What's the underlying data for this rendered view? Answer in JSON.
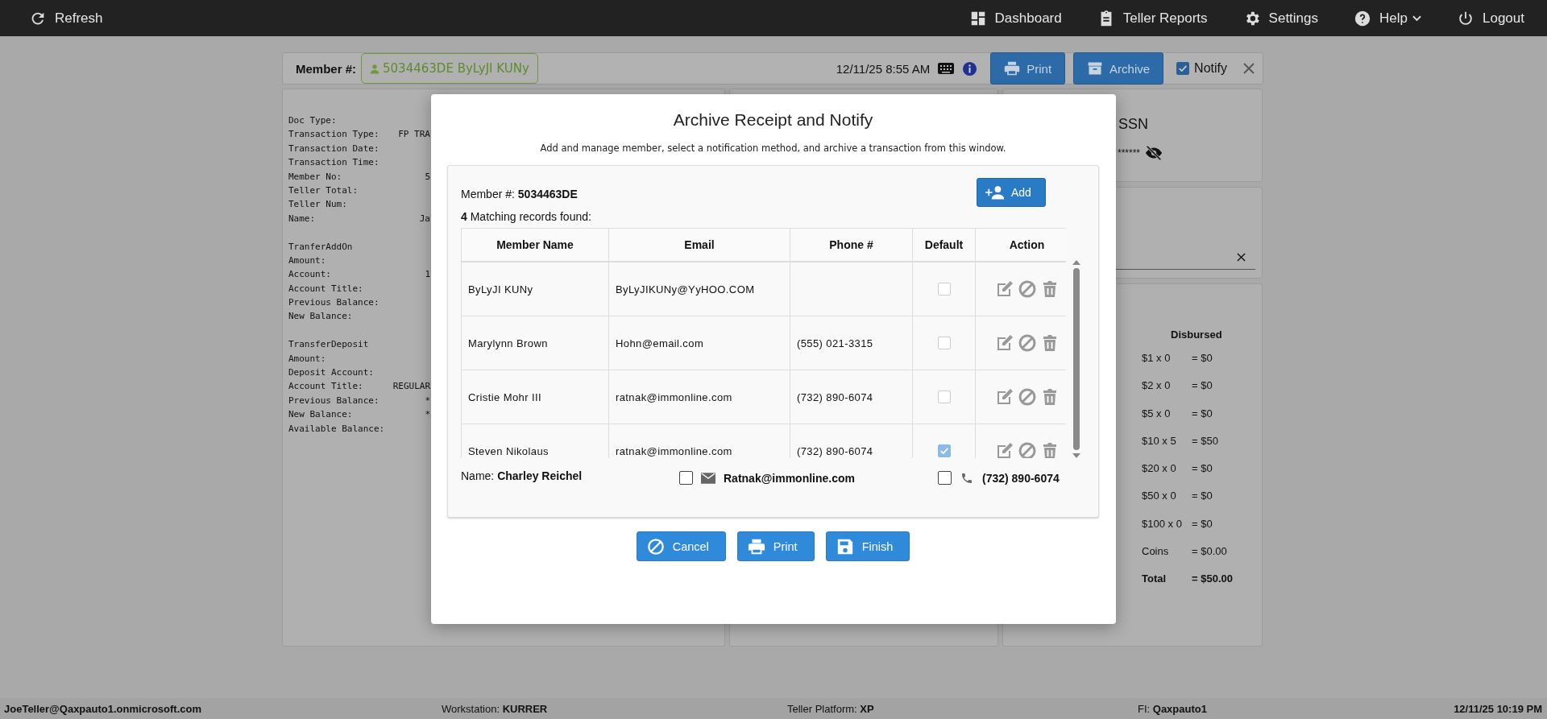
{
  "top_bar": {
    "items": [
      {
        "label": "Refresh",
        "kind": "refresh"
      },
      {
        "label": "Dashboard",
        "kind": "dashboard"
      },
      {
        "label": "Teller Reports",
        "kind": "reports"
      },
      {
        "label": "Settings",
        "kind": "settings"
      },
      {
        "label": "Help",
        "kind": "help"
      },
      {
        "label": "Logout",
        "kind": "logout"
      }
    ]
  },
  "member_bar": {
    "label": "Member #:",
    "member": "5034463DE ByLyJI KUNy",
    "datetime": "12/11/25 8:55 AM",
    "buttons": [
      {
        "label": "Print",
        "kind": "print"
      },
      {
        "label": "Archive",
        "kind": "archive"
      }
    ],
    "notify": {
      "label": "Notify",
      "checked": true
    }
  },
  "receipt": {
    "sections": [
      {
        "lines": [
          {
            "label": "Doc Type:"
          },
          {
            "label": "Transaction Type:",
            "value": "FP TRA"
          },
          {
            "label": "Transaction Date:"
          },
          {
            "label": "Transaction Time:"
          },
          {
            "label": "Member No:",
            "value": "5"
          },
          {
            "label": "Teller Total:"
          },
          {
            "label": "Teller Num:"
          },
          {
            "label": "Name:",
            "value": "Ja"
          }
        ]
      },
      {
        "title": "TranferAddOn",
        "lines": [
          {
            "label": "Amount:"
          },
          {
            "label": "Account:",
            "value": "1"
          },
          {
            "label": "Account Title:"
          },
          {
            "label": "Previous Balance:"
          },
          {
            "label": "New Balance:"
          }
        ]
      },
      {
        "title": "TransferDeposit",
        "lines": [
          {
            "label": "Amount:"
          },
          {
            "label": "Deposit Account:"
          },
          {
            "label": "Account Title:",
            "value": "REGULAR"
          },
          {
            "label": "Previous Balance:",
            "value": "*"
          },
          {
            "label": "New Balance:",
            "value": "*"
          },
          {
            "label": "Available Balance:"
          }
        ]
      }
    ]
  },
  "ssn": {
    "label": "SSN",
    "value": "******"
  },
  "disbursed": {
    "title": "Disbursed",
    "rows": [
      {
        "denomination": "$1 x 0",
        "amount": "= $0",
        "kind": "row"
      },
      {
        "denomination": "$2 x 0",
        "amount": "= $0",
        "kind": "row"
      },
      {
        "denomination": "$5 x 0",
        "amount": "= $0",
        "kind": "row"
      },
      {
        "denomination": "$10 x 5",
        "amount": "= $50",
        "kind": "row"
      },
      {
        "denomination": "$20 x 0",
        "amount": "= $0",
        "kind": "row"
      },
      {
        "denomination": "$50 x 0",
        "amount": "= $0",
        "kind": "row"
      },
      {
        "denomination": "$100 x 0",
        "amount": "= $0",
        "kind": "row"
      },
      {
        "denomination": "Coins",
        "amount": "= $0.00",
        "kind": "row"
      },
      {
        "denomination": "Total",
        "amount": "= $50.00",
        "kind": "total"
      }
    ]
  },
  "modal": {
    "title": "Archive Receipt and Notify",
    "subtitle": "Add and manage member, select a notification method, and archive a transaction from this window.",
    "member_label": "Member #:",
    "member_number": "5034463DE",
    "add_button": "Add",
    "matching": "**4** Matching records found:",
    "table": {
      "columns": [
        "Member Name",
        "Email",
        "Phone #",
        "Default",
        "Action"
      ],
      "rows": [
        {
          "name": "ByLyJI KUNy",
          "email": "ByLyJIKUNy@YyHOO.COM",
          "default": false
        },
        {
          "name": "Marylynn Brown",
          "email": "Hohn@email.com",
          "phone": "(555) 021-3315",
          "default": false
        },
        {
          "name": "Cristie Mohr III",
          "email": "ratnak@immonline.com",
          "phone": "(732) 890-6074",
          "default": false
        },
        {
          "name": "Steven Nikolaus",
          "email": "ratnak@immonline.com",
          "phone": "(732) 890-6074",
          "default": true
        }
      ]
    },
    "name_label": "Name:",
    "name": "Charley Reichel",
    "email_option": {
      "label": "Ratnak@immonline.com",
      "checked": false
    },
    "phone_option": {
      "label": "(732) 890-6074",
      "checked": false
    },
    "buttons": [
      {
        "label": "Cancel",
        "kind": "cancel"
      },
      {
        "label": "Print",
        "kind": "print"
      },
      {
        "label": "Finish",
        "kind": "finish"
      }
    ]
  },
  "status_bar": {
    "user": "JoeTeller@Qaxpauto1.onmicrosoft.com",
    "fields": [
      {
        "label": "Workstation:",
        "value": "KURRER"
      },
      {
        "label": "Teller Platform:",
        "value": "XP"
      },
      {
        "label": "FI:",
        "value": "Qaxpauto1"
      }
    ],
    "datetime": "12/11/25 10:19 PM"
  }
}
